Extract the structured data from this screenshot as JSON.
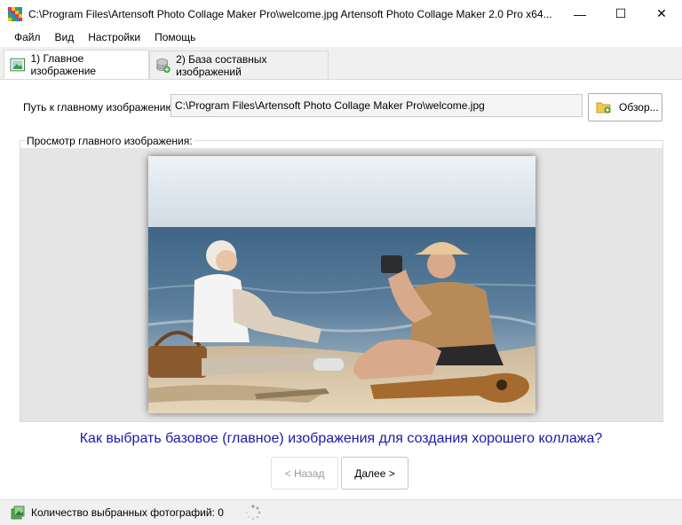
{
  "window": {
    "title": "C:\\Program Files\\Artensoft Photo Collage Maker Pro\\welcome.jpg Artensoft Photo Collage Maker  2.0 Pro x64...",
    "minimize_glyph": "—",
    "maximize_glyph": "☐",
    "close_glyph": "✕"
  },
  "menu": {
    "items": [
      {
        "label": "Файл"
      },
      {
        "label": "Вид"
      },
      {
        "label": "Настройки"
      },
      {
        "label": "Помощь"
      }
    ]
  },
  "tabs": [
    {
      "label": "1) Главное изображение",
      "active": true,
      "icon": "image-icon"
    },
    {
      "label": "2) База составных изображений",
      "active": false,
      "icon": "database-add-icon"
    }
  ],
  "main": {
    "path_label": "Путь к главному изображению:",
    "path_value": "C:\\Program Files\\Artensoft Photo Collage Maker Pro\\welcome.jpg",
    "browse_label": "Обзор...",
    "preview_label": "Просмотр главного изображения:",
    "help_link": "Как выбрать базовое (главное) изображения для создания хорошего коллажа?",
    "back_label": "< Назад",
    "next_label": "Далее >"
  },
  "status": {
    "text": "Количество выбранных фотографий: 0"
  },
  "colors": {
    "link": "#1a1aa6",
    "sea": "#4f6f8f",
    "sky": "#d8e2ea",
    "sand": "#d9c4a3"
  }
}
